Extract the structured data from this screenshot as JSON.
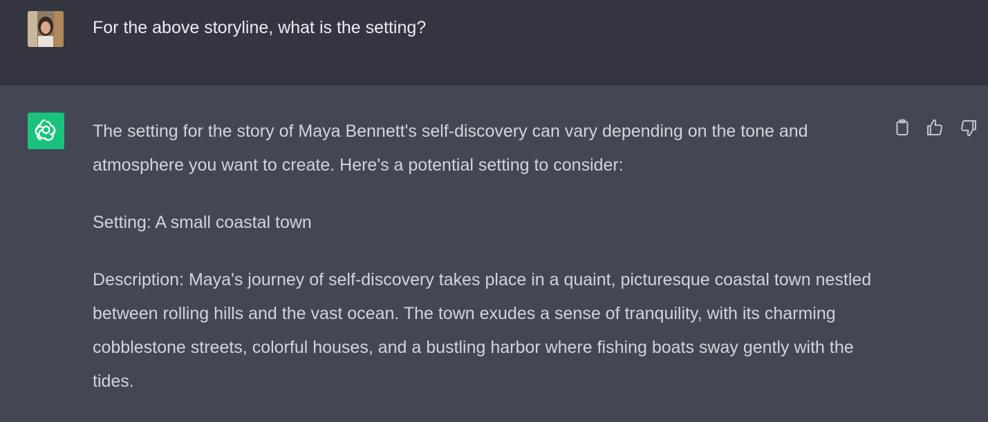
{
  "user_message": {
    "text": "For the above storyline, what is the setting?"
  },
  "assistant_message": {
    "paragraphs": [
      "The setting for the story of Maya Bennett's self-discovery can vary depending on the tone and atmosphere you want to create. Here's a potential setting to consider:",
      "Setting: A small coastal town",
      "Description: Maya's journey of self-discovery takes place in a quaint, picturesque coastal town nestled between rolling hills and the vast ocean. The town exudes a sense of tranquility, with its charming cobblestone streets, colorful houses, and a bustling harbor where fishing boats sway gently with the tides."
    ]
  },
  "actions": {
    "copy_icon": "clipboard-icon",
    "like_icon": "thumbs-up-icon",
    "dislike_icon": "thumbs-down-icon"
  },
  "colors": {
    "user_bg": "#343541",
    "assistant_bg": "#444654",
    "bot_avatar": "#19c37d",
    "text": "#d1d5db"
  }
}
